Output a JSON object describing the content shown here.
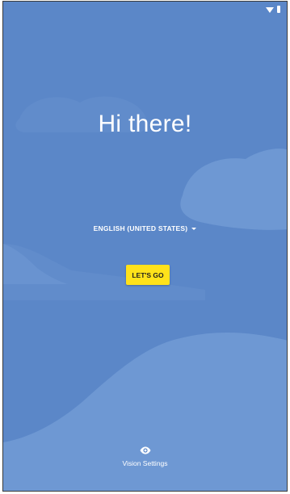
{
  "colors": {
    "background": "#5b87c8",
    "button": "#ffe21a",
    "text": "#ffffff"
  },
  "status_bar": {
    "icons": [
      "wifi-icon",
      "battery-icon"
    ]
  },
  "welcome": {
    "title": "Hi there!",
    "language": "ENGLISH (UNITED STATES)",
    "start_button": "LET'S GO"
  },
  "footer": {
    "vision_settings_label": "Vision Settings",
    "vision_settings_icon": "eye-icon"
  }
}
